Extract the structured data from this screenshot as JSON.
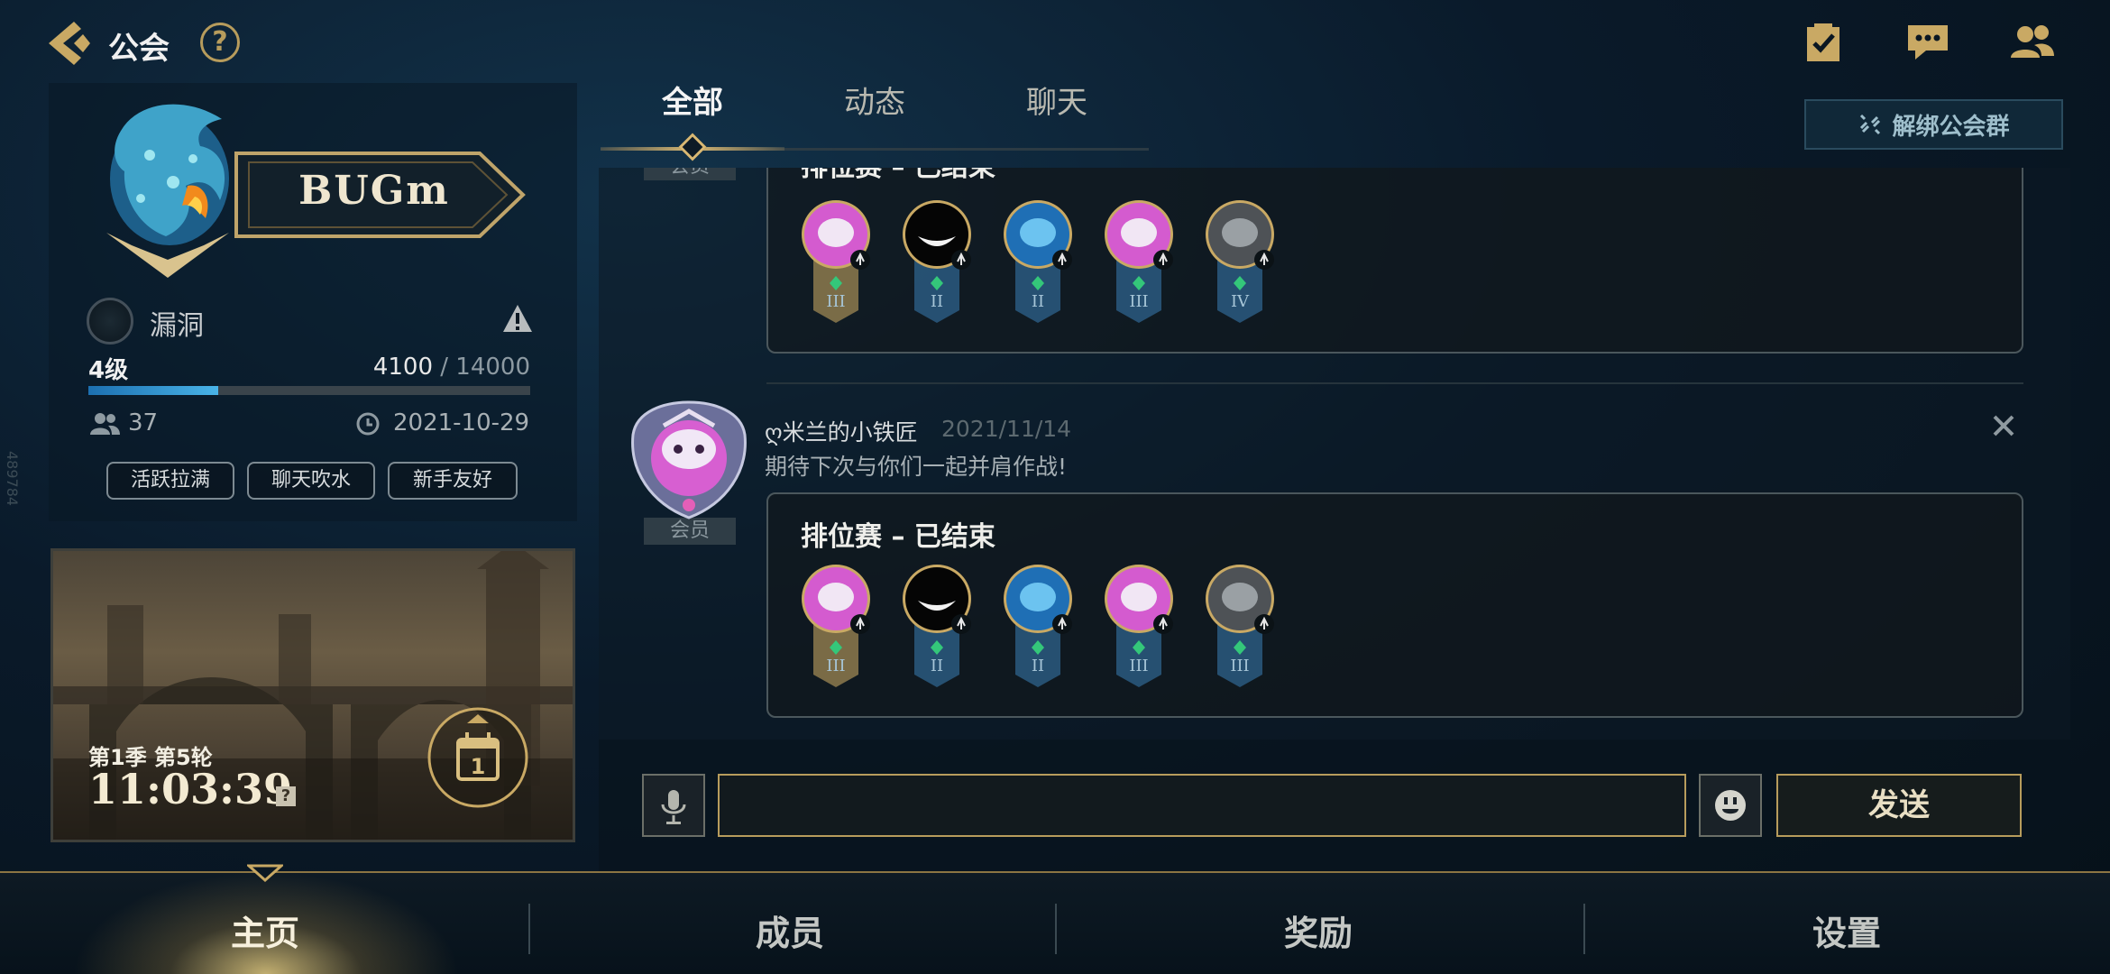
{
  "header": {
    "title": "公会",
    "help_glyph": "?"
  },
  "tabs": [
    {
      "label": "全部",
      "active": true
    },
    {
      "label": "动态",
      "active": false
    },
    {
      "label": "聊天",
      "active": false
    }
  ],
  "unbind_button": {
    "label": "解绑公会群",
    "icon": "unlink-icon"
  },
  "guild": {
    "name": "BUGm",
    "status_label": "漏洞",
    "level_label": "4级",
    "exp_current": "4100",
    "exp_max": " / 14000",
    "exp_fraction": 0.293,
    "member_count": "37",
    "created_date": "2021-10-29",
    "tags": [
      "活跃拉满",
      "聊天吹水",
      "新手友好"
    ],
    "side_id": "489784"
  },
  "season": {
    "label": "第1季 第5轮",
    "timer": "11:03:39",
    "help_glyph": "?",
    "calendar_number": "1"
  },
  "feed": {
    "posts": [
      {
        "badge": "会员",
        "match_title": "排位赛 – 已结束",
        "ranks": [
          "III",
          "II",
          "II",
          "III",
          "IV"
        ]
      },
      {
        "user": "ღ米兰的小铁匠",
        "date": "2021/11/14",
        "text": "期待下次与你们一起并肩作战!",
        "badge": "会员",
        "match_title": "排位赛 – 已结束",
        "ranks": [
          "III",
          "II",
          "II",
          "III",
          "III"
        ]
      }
    ]
  },
  "input": {
    "placeholder": "",
    "send_label": "发送"
  },
  "bottom_nav": [
    {
      "label": "主页",
      "active": true
    },
    {
      "label": "成员",
      "active": false
    },
    {
      "label": "奖励",
      "active": false
    },
    {
      "label": "设置",
      "active": false
    }
  ],
  "colors": {
    "accent_gold": "#b79c5c",
    "exp_blue": "#49b4e8",
    "background": "#0a1a2a"
  }
}
